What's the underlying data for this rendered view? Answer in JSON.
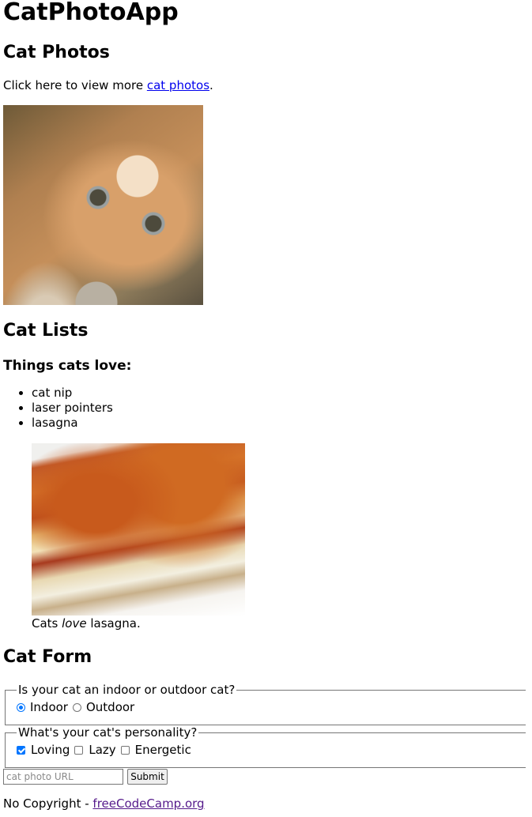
{
  "header": {
    "title": "CatPhotoApp"
  },
  "photos": {
    "heading": "Cat Photos",
    "intro_text": "Click here to view more ",
    "link_text": "cat photos",
    "intro_end": ".",
    "image_alt": "A cute orange cat lying on its back."
  },
  "lists": {
    "heading": "Cat Lists",
    "subheading": "Things cats love:",
    "items": [
      "cat nip",
      "laser pointers",
      "lasagna"
    ],
    "image_alt": "A slice of lasagna on a plate.",
    "caption_before": "Cats ",
    "caption_em": "love",
    "caption_after": " lasagna."
  },
  "form": {
    "heading": "Cat Form",
    "location_legend": "Is your cat an indoor or outdoor cat?",
    "location_options": [
      {
        "label": "Indoor",
        "checked": true
      },
      {
        "label": "Outdoor",
        "checked": false
      }
    ],
    "personality_legend": "What's your cat's personality?",
    "personality_options": [
      {
        "label": "Loving",
        "checked": true
      },
      {
        "label": "Lazy",
        "checked": false
      },
      {
        "label": "Energetic",
        "checked": false
      }
    ],
    "url_placeholder": "cat photo URL",
    "submit_label": "Submit"
  },
  "footer": {
    "text": "No Copyright - ",
    "link_text": "freeCodeCamp.org"
  },
  "colors": {
    "link": "#0000ee",
    "visited_link": "#551a8b",
    "control_accent": "#0075ff"
  }
}
